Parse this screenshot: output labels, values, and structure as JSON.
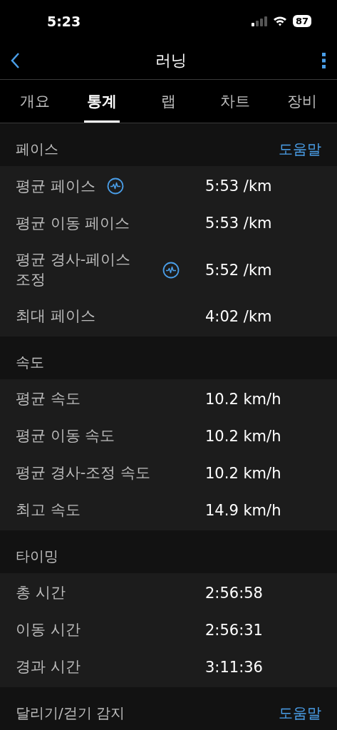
{
  "status_bar": {
    "time": "5:23",
    "battery": "87"
  },
  "nav": {
    "title": "러닝"
  },
  "tabs": [
    {
      "label": "개요",
      "selected": false
    },
    {
      "label": "통계",
      "selected": true
    },
    {
      "label": "랩",
      "selected": false
    },
    {
      "label": "차트",
      "selected": false
    },
    {
      "label": "장비",
      "selected": false
    }
  ],
  "sections": [
    {
      "title": "페이스",
      "help": "도움말",
      "rows": [
        {
          "label": "평균 페이스",
          "info": true,
          "value": "5:53 /km"
        },
        {
          "label": "평균 이동 페이스",
          "info": false,
          "value": "5:53 /km"
        },
        {
          "label": "평균 경사-페이스 조정",
          "info": true,
          "value": "5:52 /km"
        },
        {
          "label": "최대 페이스",
          "info": false,
          "value": "4:02 /km"
        }
      ]
    },
    {
      "title": "속도",
      "rows": [
        {
          "label": "평균 속도",
          "info": false,
          "value": "10.2 km/h"
        },
        {
          "label": "평균 이동 속도",
          "info": false,
          "value": "10.2 km/h"
        },
        {
          "label": "평균 경사-조정 속도",
          "info": false,
          "value": "10.2 km/h"
        },
        {
          "label": "최고 속도",
          "info": false,
          "value": "14.9 km/h"
        }
      ]
    },
    {
      "title": "타이밍",
      "rows": [
        {
          "label": "총 시간",
          "info": false,
          "value": "2:56:58"
        },
        {
          "label": "이동 시간",
          "info": false,
          "value": "2:56:31"
        },
        {
          "label": "경과 시간",
          "info": false,
          "value": "3:11:36"
        }
      ]
    },
    {
      "title": "달리기/걷기 감지",
      "help": "도움말"
    }
  ]
}
